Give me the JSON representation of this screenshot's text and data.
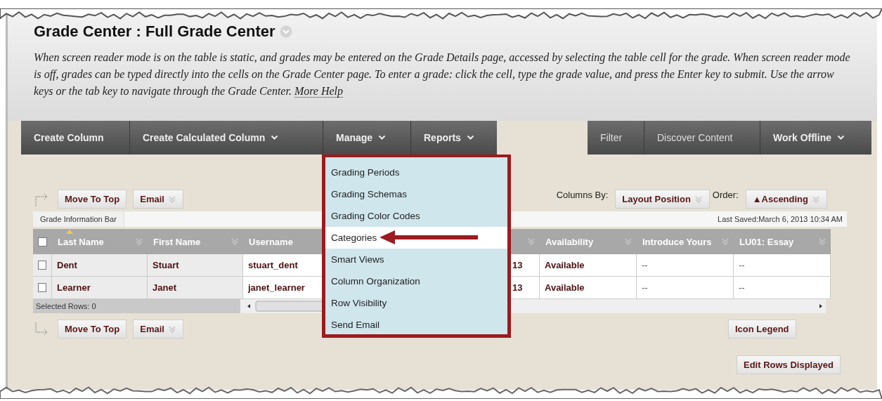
{
  "title": "Grade Center : Full Grade Center",
  "description": {
    "text": "When screen reader mode is on the table is static, and grades may be entered on the Grade Details page, accessed by selecting the table cell for the grade. When screen reader mode is off, grades can be typed directly into the cells on the Grade Center page. To enter a grade: click the cell, type the grade value, and press the Enter key to submit. Use the arrow keys or the tab key to navigate through the Grade Center.",
    "link": "More Help"
  },
  "nav_left": [
    {
      "label": "Create Column",
      "kind": "action",
      "dropdown": false
    },
    {
      "label": "Create Calculated Column",
      "kind": "action",
      "dropdown": true
    },
    {
      "label": "Manage",
      "kind": "action",
      "dropdown": true
    },
    {
      "label": "Reports",
      "kind": "action",
      "dropdown": true
    }
  ],
  "nav_right": [
    {
      "label": "Filter",
      "kind": "link",
      "dropdown": false
    },
    {
      "label": "Discover Content",
      "kind": "link",
      "dropdown": false
    },
    {
      "label": "Work Offline",
      "kind": "action",
      "dropdown": true
    }
  ],
  "manage_menu": [
    {
      "label": "Grading Periods",
      "selected": false
    },
    {
      "label": "Grading Schemas",
      "selected": false
    },
    {
      "label": "Grading Color Codes",
      "selected": false
    },
    {
      "label": "Categories",
      "selected": true
    },
    {
      "label": "Smart Views",
      "selected": false
    },
    {
      "label": "Column Organization",
      "selected": false
    },
    {
      "label": "Row Visibility",
      "selected": false
    },
    {
      "label": "Send Email",
      "selected": false
    }
  ],
  "top_actions": [
    {
      "label": "Move To Top",
      "dropdown": false
    },
    {
      "label": "Email",
      "dropdown": true
    }
  ],
  "sort": {
    "columns_label": "Columns By:",
    "columns_value": "Layout Position",
    "order_label": "Order:",
    "order_value": "▲Ascending"
  },
  "info_bar": {
    "label": "Grade Information Bar",
    "last_saved": "Last Saved:March 6, 2013 10:34 AM"
  },
  "table": {
    "select_all_checked": false,
    "columns": [
      {
        "label": "Last Name",
        "sorted": true
      },
      {
        "label": "First Name",
        "sorted": false
      },
      {
        "label": "Username",
        "sorted": false
      },
      {
        "sorted": false
      },
      {
        "label": "Availability",
        "sorted": false
      },
      {
        "label": "Introduce Yours",
        "sorted": false
      },
      {
        "label": "LU01: Essay",
        "sorted": false
      }
    ],
    "rows": [
      {
        "checked": false,
        "cells": [
          "Dent",
          "Stuart",
          "stuart_dent",
          "13",
          "Available",
          "--",
          "--"
        ]
      },
      {
        "checked": false,
        "cells": [
          "Learner",
          "Janet",
          "janet_learner",
          "13",
          "Available",
          "--",
          "--"
        ]
      }
    ],
    "selected_rows": "Selected Rows: 0"
  },
  "bottom_actions": [
    {
      "label": "Move To Top",
      "dropdown": false
    },
    {
      "label": "Email",
      "dropdown": true
    }
  ],
  "icon_legend": "Icon Legend",
  "edit_rows": "Edit Rows Displayed"
}
